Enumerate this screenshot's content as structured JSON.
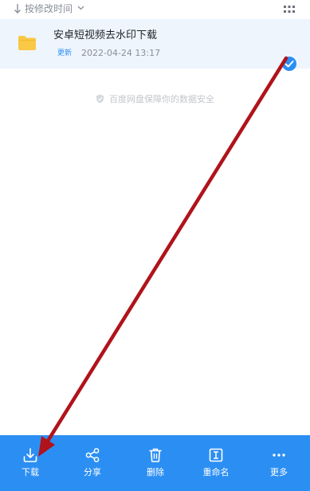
{
  "sort": {
    "label": "按修改时间"
  },
  "file": {
    "name": "安卓短视频去水印下载",
    "badge": "更新",
    "date": "2022-04-24  13:17",
    "selected": true
  },
  "security": {
    "text": "百度网盘保障你的数据安全"
  },
  "toolbar": {
    "download": "下载",
    "share": "分享",
    "delete": "删除",
    "rename": "重命名",
    "more": "更多"
  },
  "colors": {
    "accent": "#2b8ef3",
    "folder": "#f9c844",
    "selected_row": "#eef5fd",
    "annotation_arrow": "#b0131b"
  },
  "icons": {
    "sort": "arrow-down-icon",
    "view": "grid-icon",
    "file": "folder-icon",
    "selection": "check-circle-icon",
    "security": "shield-icon",
    "download": "download-icon",
    "share": "share-icon",
    "delete": "trash-icon",
    "rename": "rename-icon",
    "more": "more-icon"
  }
}
